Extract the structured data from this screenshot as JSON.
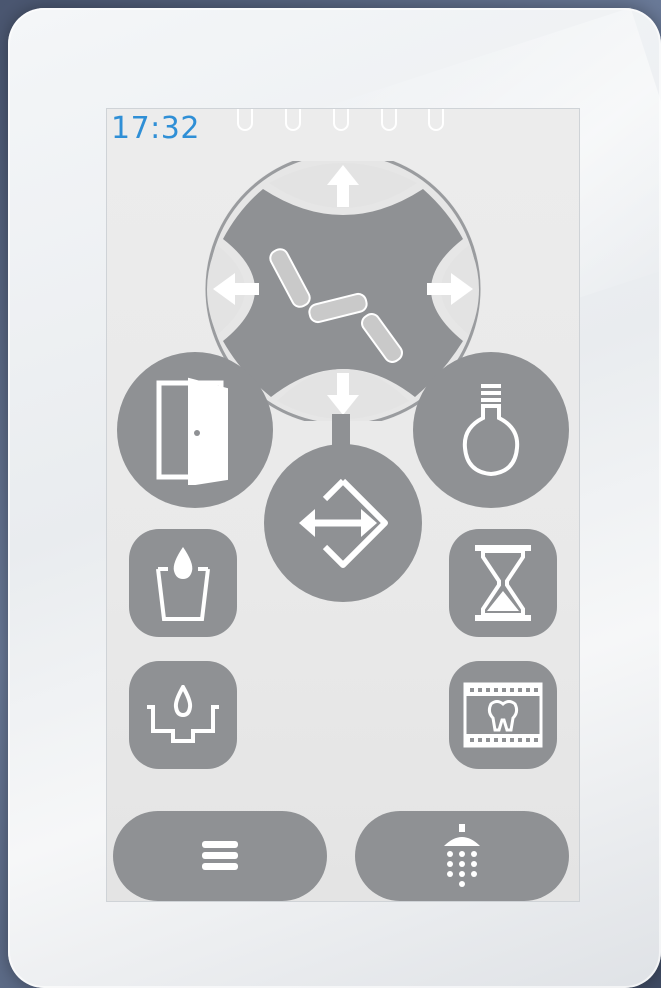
{
  "status_bar": {
    "time": "17:32",
    "time_color": "#2f8fd6",
    "tab_slot_count": 5
  },
  "chair_control": {
    "up_icon": "arrow-up-icon",
    "down_icon": "arrow-down-icon",
    "left_icon": "arrow-left-icon",
    "right_icon": "arrow-right-icon",
    "center_icon": "dental-chair-icon"
  },
  "buttons": {
    "door": "door-icon",
    "light": "light-bulb-icon",
    "entry_exit": "entry-exit-icon",
    "cup_fill": "cup-fill-icon",
    "timer": "hourglass-icon",
    "bowl_rinse": "bowl-rinse-icon",
    "xray_film": "tooth-film-icon",
    "menu": "menu-icon",
    "shower": "shower-icon"
  },
  "colors": {
    "button_gray": "#8f9194",
    "icon_white": "#ffffff",
    "screen_bg": "#ebebeb",
    "frame": "#eef0f2"
  }
}
